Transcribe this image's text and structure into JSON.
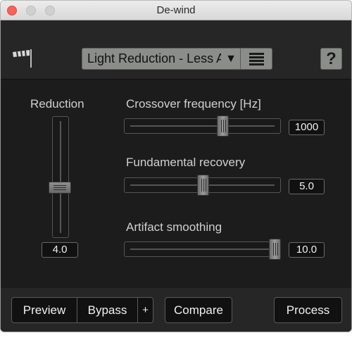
{
  "window": {
    "title": "De-wind"
  },
  "header": {
    "logo_icon": "windsock-icon",
    "preset": {
      "label": "Light Reduction - Less Artifacts",
      "arrow": "▼",
      "menu_icon": "list-icon"
    },
    "help_label": "?"
  },
  "controls": {
    "reduction": {
      "label": "Reduction",
      "value": "4.0"
    },
    "crossover": {
      "label": "Crossover frequency [Hz]",
      "value": "1000"
    },
    "fundamental": {
      "label": "Fundamental recovery",
      "value": "5.0"
    },
    "artifact": {
      "label": "Artifact smoothing",
      "value": "10.0"
    }
  },
  "footer": {
    "preview_label": "Preview",
    "bypass_label": "Bypass",
    "plus_label": "+",
    "compare_label": "Compare",
    "process_label": "Process"
  },
  "colors": {
    "background": "#1c1c1c",
    "panel": "#262626",
    "accent": "#8a8d89",
    "close": "#fc605c"
  }
}
